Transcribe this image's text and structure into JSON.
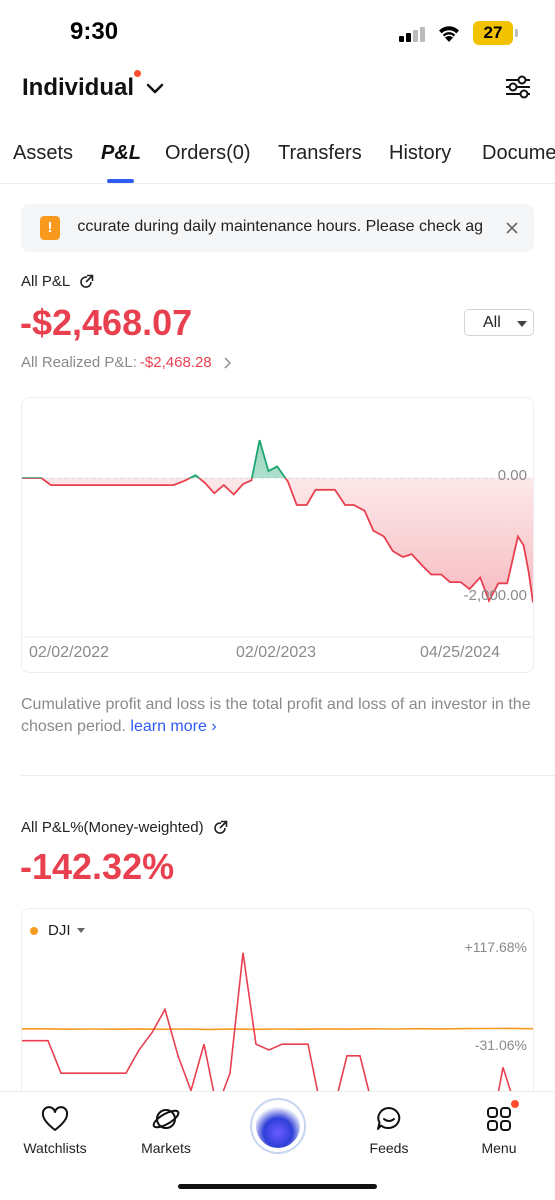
{
  "status_bar": {
    "time": "9:30",
    "battery": "27"
  },
  "header": {
    "account_name": "Individual"
  },
  "tabs": [
    {
      "label": "Assets",
      "active": false
    },
    {
      "label": "P&L",
      "active": true
    },
    {
      "label": "Orders(0)",
      "active": false
    },
    {
      "label": "Transfers",
      "active": false
    },
    {
      "label": "History",
      "active": false
    },
    {
      "label": "Docume",
      "active": false
    }
  ],
  "notice": {
    "text": "ccurate during daily maintenance hours. Please check ag"
  },
  "pnl": {
    "label": "All P&L",
    "value": "-$2,468.07",
    "range": "All",
    "realized_label": "All Realized P&L:",
    "realized_value": "-$2,468.28"
  },
  "description": {
    "text": "Cumulative profit and loss is the total profit and loss of an investor in the chosen period. ",
    "link": "learn more"
  },
  "pnl_percent": {
    "label": "All P&L%(Money-weighted)",
    "value": "-142.32%",
    "benchmark": "DJI"
  },
  "chart_data": [
    {
      "type": "area",
      "title": "All P&L",
      "y_labels": [
        "0.00",
        "-2,000.00"
      ],
      "x_tick_labels": [
        "02/02/2022",
        "02/02/2023",
        "04/25/2024"
      ],
      "ylim": [
        -2600,
        1200
      ],
      "colors": {
        "positive": "#1ea672",
        "negative": "#e8404f"
      },
      "series": [
        {
          "x": [
            "2022-02-02",
            "2022-02-20",
            "2022-03-05",
            "2022-03-20",
            "2022-04-05",
            "2022-05-01",
            "2022-06-01",
            "2022-07-01",
            "2022-08-01",
            "2022-09-01",
            "2022-10-01",
            "2022-10-20",
            "2022-11-05",
            "2022-11-20",
            "2022-12-05",
            "2022-12-20",
            "2023-01-05",
            "2023-01-20",
            "2023-02-02",
            "2023-02-15",
            "2023-03-01",
            "2023-03-15",
            "2023-04-01",
            "2023-04-15",
            "2023-05-01",
            "2023-05-15",
            "2023-06-01",
            "2023-06-15",
            "2023-07-01",
            "2023-07-15",
            "2023-08-01",
            "2023-08-15",
            "2023-09-01",
            "2023-09-15",
            "2023-10-01",
            "2023-10-15",
            "2023-11-01",
            "2023-11-15",
            "2023-12-01",
            "2023-12-15",
            "2024-01-01",
            "2024-01-15",
            "2024-02-01",
            "2024-02-15",
            "2024-03-01",
            "2024-03-15",
            "2024-04-01",
            "2024-04-10",
            "2024-04-18",
            "2024-04-25"
          ],
          "values": [
            0,
            0,
            0,
            -120,
            -120,
            -120,
            -120,
            -120,
            -120,
            -120,
            -120,
            -40,
            50,
            -80,
            -260,
            -120,
            -280,
            -100,
            -40,
            650,
            120,
            200,
            -60,
            -460,
            -460,
            -200,
            -200,
            -200,
            -460,
            -460,
            -560,
            -900,
            -1000,
            -1250,
            -1350,
            -1300,
            -1500,
            -1650,
            -1650,
            -1780,
            -1780,
            -1900,
            -1700,
            -2100,
            -1800,
            -1800,
            -1000,
            -1150,
            -1600,
            -2130
          ]
        }
      ]
    },
    {
      "type": "line",
      "title": "All P&L%(Money-weighted)",
      "y_labels": [
        "+117.68%",
        "-31.06%"
      ],
      "colors": {
        "portfolio": "#e8404f",
        "benchmark": "#f59a23"
      },
      "series": [
        {
          "name": "DJI",
          "values": [
            -31.06,
            -31.06,
            -35,
            -33,
            -35,
            -32,
            -36,
            -33,
            -37,
            -34,
            -36,
            -33,
            -35,
            -32,
            -34,
            -31,
            -33,
            -30,
            -32,
            -29,
            -28,
            -27,
            -30
          ]
        },
        {
          "values": [
            -34,
            -34,
            -34,
            -90,
            -90,
            -90,
            -90,
            -90,
            -90,
            -50,
            -20,
            20,
            -60,
            -120,
            -40,
            -150,
            -90,
            117.68,
            -40,
            -50,
            -40,
            -40,
            -40,
            -150,
            -150,
            -60,
            -60,
            -150,
            -150,
            -180,
            -200,
            -210,
            -240,
            -190,
            -220,
            -160,
            -200,
            -80,
            -150,
            -200
          ]
        }
      ]
    }
  ],
  "bottom_nav": [
    {
      "label": "Watchlists"
    },
    {
      "label": "Markets"
    },
    {
      "label": "Feeds"
    },
    {
      "label": "Menu"
    }
  ]
}
